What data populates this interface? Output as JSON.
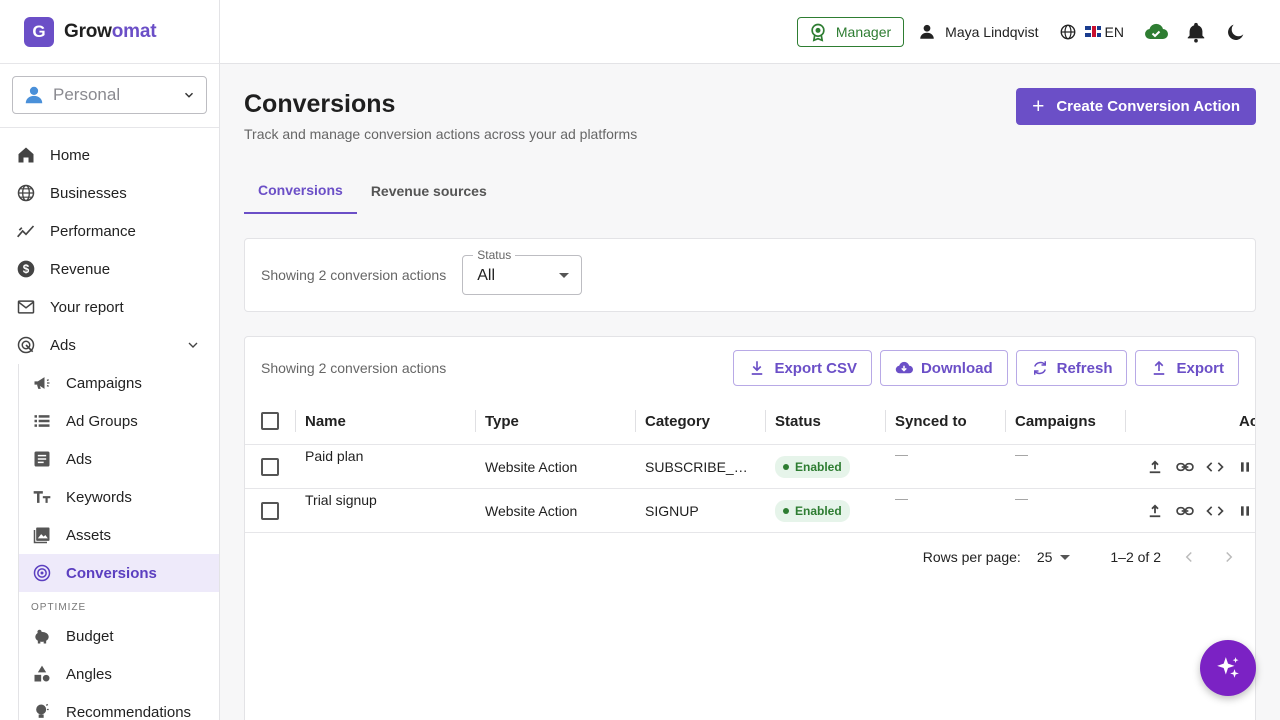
{
  "brand": {
    "logo_letter": "G",
    "name_part1": "Grow",
    "name_part2": "omat"
  },
  "workspace": {
    "label": "Personal"
  },
  "sidebar": {
    "items": [
      {
        "label": "Home",
        "icon": "home-icon"
      },
      {
        "label": "Businesses",
        "icon": "globe-icon"
      },
      {
        "label": "Performance",
        "icon": "trend-icon"
      },
      {
        "label": "Revenue",
        "icon": "dollar-icon"
      },
      {
        "label": "Your report",
        "icon": "report-icon"
      },
      {
        "label": "Ads",
        "icon": "target-icon"
      }
    ],
    "ads_sub": [
      {
        "label": "Campaigns",
        "icon": "megaphone-icon"
      },
      {
        "label": "Ad Groups",
        "icon": "list-icon"
      },
      {
        "label": "Ads",
        "icon": "article-icon"
      },
      {
        "label": "Keywords",
        "icon": "text-size-icon"
      },
      {
        "label": "Assets",
        "icon": "image-icon"
      },
      {
        "label": "Conversions",
        "icon": "conversion-icon",
        "active": true
      }
    ],
    "optimize_label": "OPTIMIZE",
    "optimize_items": [
      {
        "label": "Budget",
        "icon": "piggy-bank-icon"
      },
      {
        "label": "Angles",
        "icon": "shapes-icon"
      },
      {
        "label": "Recommendations",
        "icon": "lightbulb-icon"
      }
    ]
  },
  "topbar": {
    "manager_label": "Manager",
    "user_name": "Maya Lindqvist",
    "language": "EN"
  },
  "page": {
    "title": "Conversions",
    "subtitle": "Track and manage conversion actions across your ad platforms",
    "create_button": "Create Conversion Action",
    "tabs": [
      {
        "label": "Conversions",
        "active": true
      },
      {
        "label": "Revenue sources",
        "active": false
      }
    ]
  },
  "filter": {
    "summary": "Showing 2 conversion actions",
    "status_label": "Status",
    "status_value": "All"
  },
  "table": {
    "summary": "Showing 2 conversion actions",
    "buttons": {
      "export_csv": "Export CSV",
      "download": "Download",
      "refresh": "Refresh",
      "export": "Export"
    },
    "columns": [
      "Name",
      "Type",
      "Category",
      "Status",
      "Synced to",
      "Campaigns",
      "Ac"
    ],
    "rows": [
      {
        "name": "Paid plan",
        "type": "Website Action",
        "category": "SUBSCRIBE_…",
        "status": "Enabled",
        "synced_to": "—",
        "campaigns": "—"
      },
      {
        "name": "Trial signup",
        "type": "Website Action",
        "category": "SIGNUP",
        "status": "Enabled",
        "synced_to": "—",
        "campaigns": "—"
      }
    ],
    "pagination": {
      "rows_per_page_label": "Rows per page:",
      "rows_per_page": "25",
      "range": "1–2 of 2"
    }
  },
  "colors": {
    "accent": "#6b4fc7",
    "success": "#2e7d32",
    "fab": "#7b22c4"
  }
}
